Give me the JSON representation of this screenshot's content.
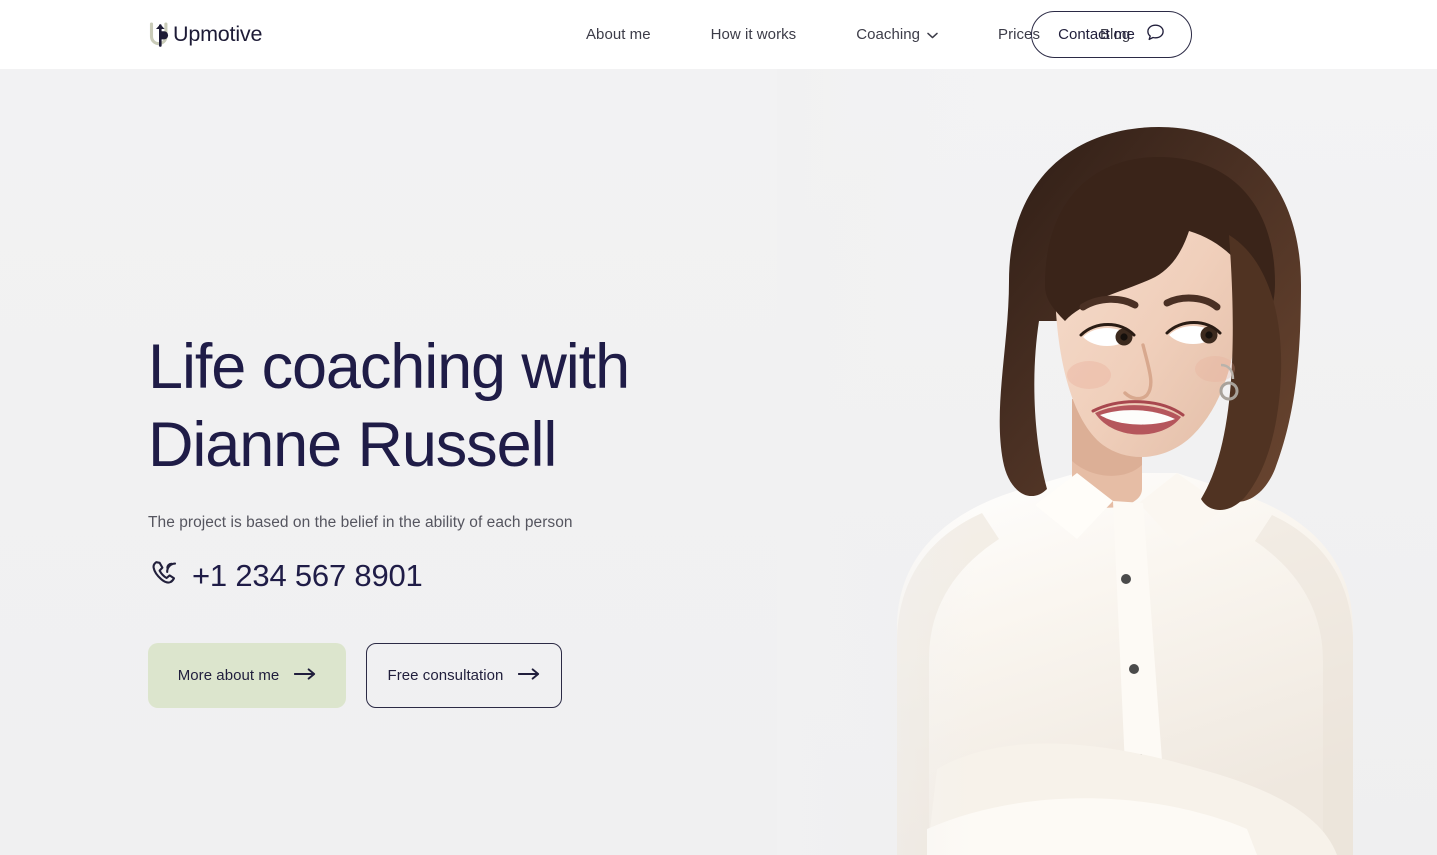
{
  "brand": {
    "name": "Upmotive",
    "logo_icon": "up-arrow-logo-icon",
    "accent_green": "#dce5cd",
    "ink": "#1f1c47"
  },
  "header": {
    "nav": [
      {
        "label": "About me",
        "icon": null
      },
      {
        "label": "How it works",
        "icon": null
      },
      {
        "label": "Coaching",
        "icon": "chevron-down-icon"
      },
      {
        "label": "Prices",
        "icon": null
      },
      {
        "label": "Blog",
        "icon": null
      }
    ],
    "contact": {
      "label": "Contact me",
      "icon": "chat-bubble-icon"
    }
  },
  "hero": {
    "title": "Life coaching with\nDianne Russell",
    "subtitle": "The project is based on the belief in the ability of each person",
    "phone": {
      "icon": "phone-ringing-icon",
      "number": "+1 234 567 8901"
    },
    "actions": [
      {
        "label": "More about me",
        "icon": "arrow-right-icon",
        "style": "primary"
      },
      {
        "label": "Free consultation",
        "icon": "arrow-right-icon",
        "style": "outline"
      }
    ],
    "photo": {
      "alt": "Smiling woman with shoulder-length brown hair wearing a cream button-up shirt with arms crossed",
      "background": "#f1f1f2"
    }
  }
}
